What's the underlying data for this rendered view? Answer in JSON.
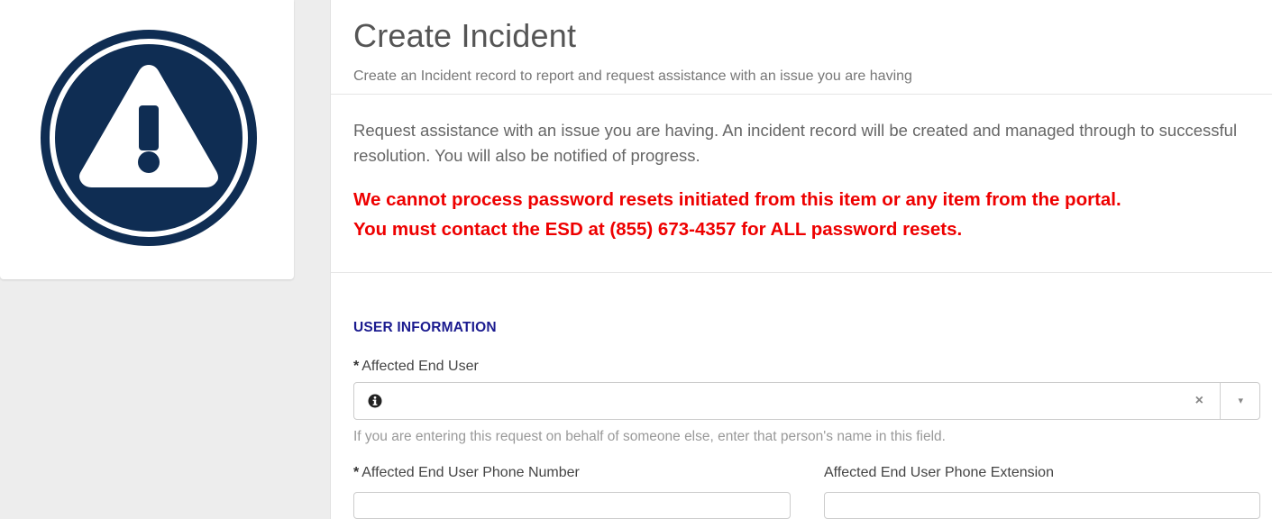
{
  "colors": {
    "icon_navy": "#0f2d53",
    "warning_red": "#ee0000",
    "section_title": "#1b1b8f"
  },
  "left_card": {
    "icon": "warning-triangle-icon"
  },
  "header": {
    "title": "Create Incident",
    "subtitle": "Create an Incident record to report and request assistance with an issue you are having"
  },
  "description": {
    "text": "Request assistance with an issue you are having. An incident record will be created and managed through to successful resolution. You will also be notified of progress.",
    "warning_line1": "We cannot process password resets initiated from this item or any item from the portal.",
    "warning_line2": "You must contact the ESD at (855) 673-4357 for ALL password resets."
  },
  "form": {
    "section_title": "USER INFORMATION",
    "affected_end_user": {
      "required_mark": "*",
      "label": "Affected End User",
      "value": "",
      "clear_glyph": "×",
      "dropdown_glyph": "▾",
      "help": "If you are entering this request on behalf of someone else, enter that person's name in this field."
    },
    "phone_number": {
      "required_mark": "*",
      "label": "Affected End User Phone Number"
    },
    "phone_extension": {
      "label": "Affected End User Phone Extension"
    }
  }
}
